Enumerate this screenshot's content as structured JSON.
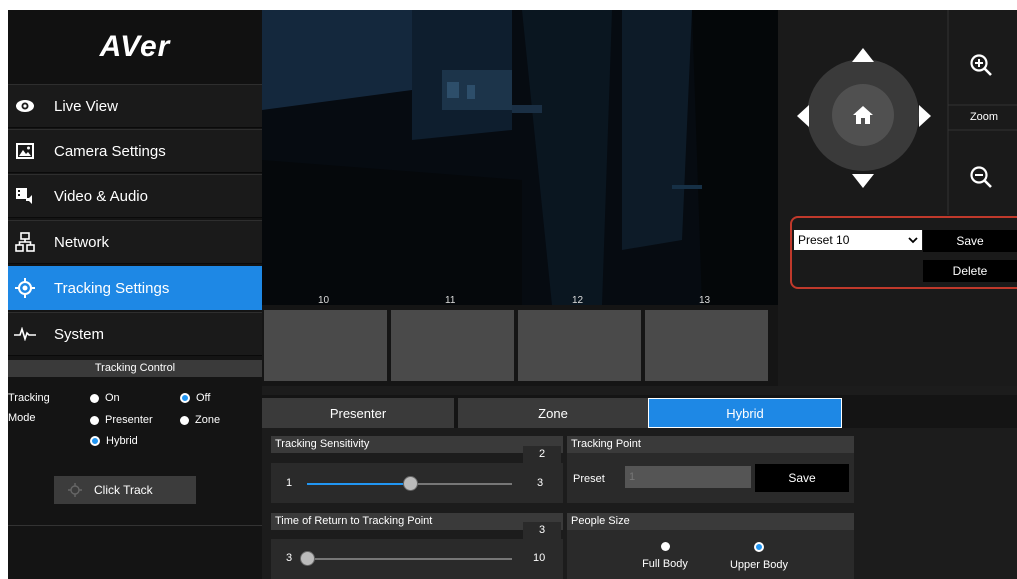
{
  "logo": "AVer",
  "sidebar": {
    "items": [
      {
        "label": "Live View",
        "icon": "eye-icon"
      },
      {
        "label": "Camera Settings",
        "icon": "image-icon"
      },
      {
        "label": "Video & Audio",
        "icon": "video-audio-icon"
      },
      {
        "label": "Network",
        "icon": "network-icon"
      },
      {
        "label": "Tracking Settings",
        "icon": "crosshair-icon",
        "active": true
      },
      {
        "label": "System",
        "icon": "pulse-icon"
      }
    ]
  },
  "tracking_control": {
    "header": "Tracking Control",
    "tracking_label": "Tracking",
    "mode_label": "Mode",
    "on_label": "On",
    "off_label": "Off",
    "off_selected": true,
    "presenter_label": "Presenter",
    "zone_label": "Zone",
    "hybrid_label": "Hybrid",
    "hybrid_selected": true,
    "click_track_label": "Click Track"
  },
  "ptz": {
    "zoom_label": "Zoom",
    "preset_select": "Preset 10",
    "save_label": "Save",
    "delete_label": "Delete"
  },
  "thumbnails": [
    "10",
    "11",
    "12",
    "13"
  ],
  "tabs": [
    {
      "label": "Presenter",
      "active": false
    },
    {
      "label": "Zone",
      "active": false
    },
    {
      "label": "Hybrid",
      "active": true
    }
  ],
  "sensitivity": {
    "title": "Tracking Sensitivity",
    "value": "2",
    "min": "1",
    "max": "3",
    "level": 0.5
  },
  "return_time": {
    "title": "Time of Return to Tracking Point",
    "value": "3",
    "min": "3",
    "max": "10",
    "level": 0
  },
  "tracking_point": {
    "title": "Tracking Point",
    "preset_label": "Preset",
    "preset_value": "1",
    "save_label": "Save"
  },
  "people_size": {
    "title": "People Size",
    "full_body": "Full Body",
    "upper_body": "Upper Body",
    "upper_selected": true
  },
  "colors": {
    "accent": "#1e88e5",
    "highlight_border": "#c0392b"
  }
}
